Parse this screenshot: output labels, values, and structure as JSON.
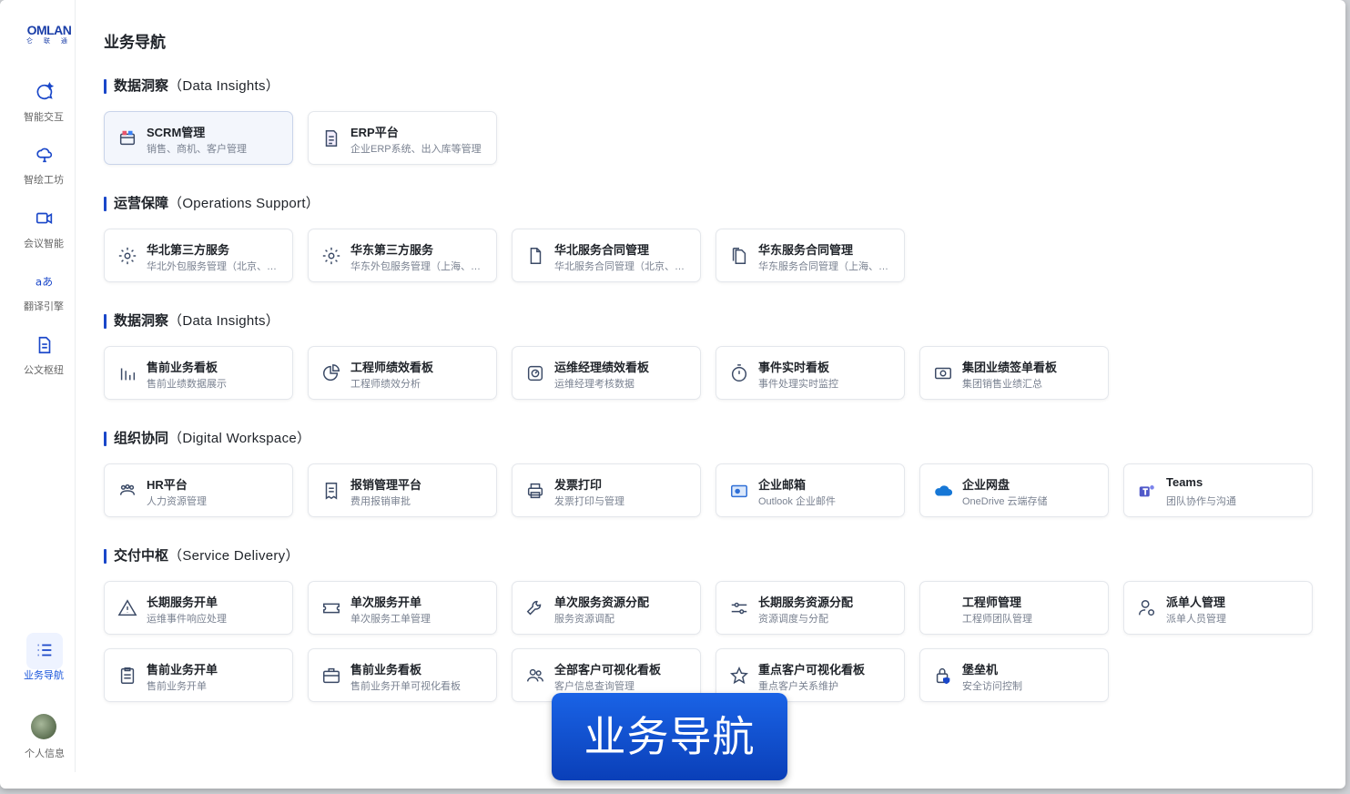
{
  "logo": {
    "brand": "OMLAN",
    "sub": "仑 联 通"
  },
  "sidebar": {
    "items": [
      {
        "label": "智能交互",
        "icon": "chat-spark-icon"
      },
      {
        "label": "智绘工坊",
        "icon": "cloud-brush-icon"
      },
      {
        "label": "会议智能",
        "icon": "video-camera-icon"
      },
      {
        "label": "翻译引擎",
        "icon": "translate-icon"
      },
      {
        "label": "公文枢纽",
        "icon": "document-icon"
      }
    ],
    "active": {
      "label": "业务导航",
      "icon": "list-icon"
    },
    "profile_label": "个人信息"
  },
  "page_title": "业务导航",
  "sections": [
    {
      "title": "数据洞察",
      "en": "（Data Insights）",
      "cards": [
        {
          "title": "SCRM管理",
          "sub": "销售、商机、客户管理",
          "icon": "scrm-icon"
        },
        {
          "title": "ERP平台",
          "sub": "企业ERP系统、出入库等管理",
          "icon": "erp-doc-icon"
        }
      ]
    },
    {
      "title": "运营保障",
      "en": "（Operations Support）",
      "cards": [
        {
          "title": "华北第三方服务",
          "sub": "华北外包服务管理（北京、天津）",
          "icon": "gear-icon"
        },
        {
          "title": "华东第三方服务",
          "sub": "华东外包服务管理（上海、江苏）",
          "icon": "gear-icon"
        },
        {
          "title": "华北服务合同管理",
          "sub": "华北服务合同管理（北京、天津）",
          "icon": "file-icon"
        },
        {
          "title": "华东服务合同管理",
          "sub": "华东服务合同管理（上海、江苏）",
          "icon": "files-icon"
        }
      ]
    },
    {
      "title": "数据洞察",
      "en": "（Data Insights）",
      "cards": [
        {
          "title": "售前业务看板",
          "sub": "售前业绩数据展示",
          "icon": "bar-chart-icon"
        },
        {
          "title": "工程师绩效看板",
          "sub": "工程师绩效分析",
          "icon": "pie-chart-icon"
        },
        {
          "title": "运维经理绩效看板",
          "sub": "运维经理考核数据",
          "icon": "gauge-icon"
        },
        {
          "title": "事件实时看板",
          "sub": "事件处理实时监控",
          "icon": "stopwatch-icon"
        },
        {
          "title": "集团业绩签单看板",
          "sub": "集团销售业绩汇总",
          "icon": "money-icon"
        }
      ]
    },
    {
      "title": "组织协同",
      "en": "（Digital Workspace）",
      "cards": [
        {
          "title": "HR平台",
          "sub": "人力资源管理",
          "icon": "team-icon"
        },
        {
          "title": "报销管理平台",
          "sub": "费用报销审批",
          "icon": "receipt-icon"
        },
        {
          "title": "发票打印",
          "sub": "发票打印与管理",
          "icon": "printer-icon"
        },
        {
          "title": "企业邮箱",
          "sub": "Outlook 企业邮件",
          "icon": "outlook-icon"
        },
        {
          "title": "企业网盘",
          "sub": "OneDrive 云端存储",
          "icon": "onedrive-icon"
        },
        {
          "title": "Teams",
          "sub": "团队协作与沟通",
          "icon": "teams-icon"
        }
      ]
    },
    {
      "title": "交付中枢",
      "en": "（Service Delivery）",
      "cards": [
        {
          "title": "长期服务开单",
          "sub": "运维事件响应处理",
          "icon": "warning-icon"
        },
        {
          "title": "单次服务开单",
          "sub": "单次服务工单管理",
          "icon": "ticket-icon"
        },
        {
          "title": "单次服务资源分配",
          "sub": "服务资源调配",
          "icon": "wrench-icon"
        },
        {
          "title": "长期服务资源分配",
          "sub": "资源调度与分配",
          "icon": "sliders-icon"
        },
        {
          "title": "工程师管理",
          "sub": "工程师团队管理",
          "icon": "engineer-icon"
        },
        {
          "title": "派单人管理",
          "sub": "派单人员管理",
          "icon": "user-gear-icon"
        },
        {
          "title": "售前业务开单",
          "sub": "售前业务开单",
          "icon": "clipboard-icon"
        },
        {
          "title": "售前业务看板",
          "sub": "售前业务开单可视化看板",
          "icon": "briefcase-icon"
        },
        {
          "title": "全部客户可视化看板",
          "sub": "客户信息查询管理",
          "icon": "users-icon"
        },
        {
          "title": "重点客户可视化看板",
          "sub": "重点客户关系维护",
          "icon": "star-icon"
        },
        {
          "title": "堡垒机",
          "sub": "安全访问控制",
          "icon": "lock-shield-icon"
        }
      ]
    }
  ],
  "overlay_banner": "业务导航"
}
